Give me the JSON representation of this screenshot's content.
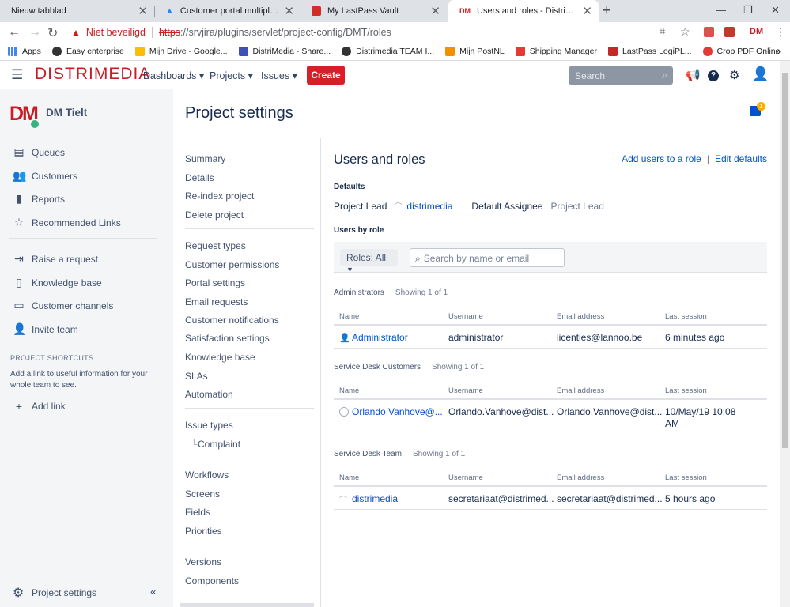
{
  "browser": {
    "tabs": [
      {
        "title": "Nieuw tabblad"
      },
      {
        "title": "Customer portal multiple project"
      },
      {
        "title": "My LastPass Vault"
      },
      {
        "title": "Users and roles - Distrimedia kla",
        "favicon": "DM"
      }
    ],
    "address": {
      "warning": "Niet beveiligd",
      "scheme": "https",
      "rest": "://srvjira/plugins/servlet/project-config/DMT/roles"
    },
    "profile": "DM",
    "bookmarks": [
      "Apps",
      "Easy enterprise",
      "Mijn Drive - Google...",
      "DistriMedia - Share...",
      "Distrimedia TEAM I...",
      "Mijn PostNL",
      "Shipping Manager",
      "LastPass LogiPL...",
      "Crop PDF Online"
    ]
  },
  "topnav": {
    "logo": "DISTRIMEDIA",
    "menus": [
      "Dashboards",
      "Projects",
      "Issues"
    ],
    "create": "Create",
    "search_placeholder": "Search"
  },
  "sidebar": {
    "avatar": "DM",
    "project": "DM Tielt",
    "items": [
      "Queues",
      "Customers",
      "Reports",
      "Recommended Links"
    ],
    "items2": [
      "Raise a request",
      "Knowledge base",
      "Customer channels",
      "Invite team"
    ],
    "shortcuts_heading": "PROJECT SHORTCUTS",
    "shortcuts_desc": "Add a link to useful information for your whole team to see.",
    "add_link": "Add link",
    "bottom": "Project settings"
  },
  "settings": {
    "title": "Project settings",
    "g1": [
      "Summary",
      "Details",
      "Re-index project",
      "Delete project"
    ],
    "g2": [
      "Request types",
      "Customer permissions",
      "Portal settings",
      "Email requests",
      "Customer notifications",
      "Satisfaction settings",
      "Knowledge base",
      "SLAs",
      "Automation"
    ],
    "g3": [
      "Issue types"
    ],
    "g3sub": "Complaint",
    "g4": [
      "Workflows",
      "Screens",
      "Fields",
      "Priorities"
    ],
    "g5": [
      "Versions",
      "Components"
    ]
  },
  "notif_count": "1",
  "main": {
    "title": "Users and roles",
    "add_users": "Add users to a role",
    "edit_defaults": "Edit defaults",
    "defaults_label": "Defaults",
    "project_lead_label": "Project Lead",
    "project_lead": "distrimedia",
    "assignee_label": "Default Assignee",
    "assignee": "Project Lead",
    "users_by_role": "Users by role",
    "roles_filter": "Roles: All",
    "search_placeholder": "Search by name or email",
    "columns": [
      "Name",
      "Username",
      "Email address",
      "Last session"
    ],
    "groups": [
      {
        "name": "Administrators",
        "count": "Showing 1 of 1",
        "row": {
          "name": "Administrator",
          "username": "administrator",
          "email": "licenties@lannoo.be",
          "last": "6 minutes ago"
        }
      },
      {
        "name": "Service Desk Customers",
        "count": "Showing 1 of 1",
        "row": {
          "name": "Orlando.Vanhove@...",
          "username": "Orlando.Vanhove@dist...",
          "email": "Orlando.Vanhove@dist...",
          "last": "10/May/19 10:08 AM"
        }
      },
      {
        "name": "Service Desk Team",
        "count": "Showing 1 of 1",
        "row": {
          "name": "distrimedia",
          "username": "secretariaat@distrimed...",
          "email": "secretariaat@distrimed...",
          "last": "5 hours ago"
        }
      }
    ]
  }
}
